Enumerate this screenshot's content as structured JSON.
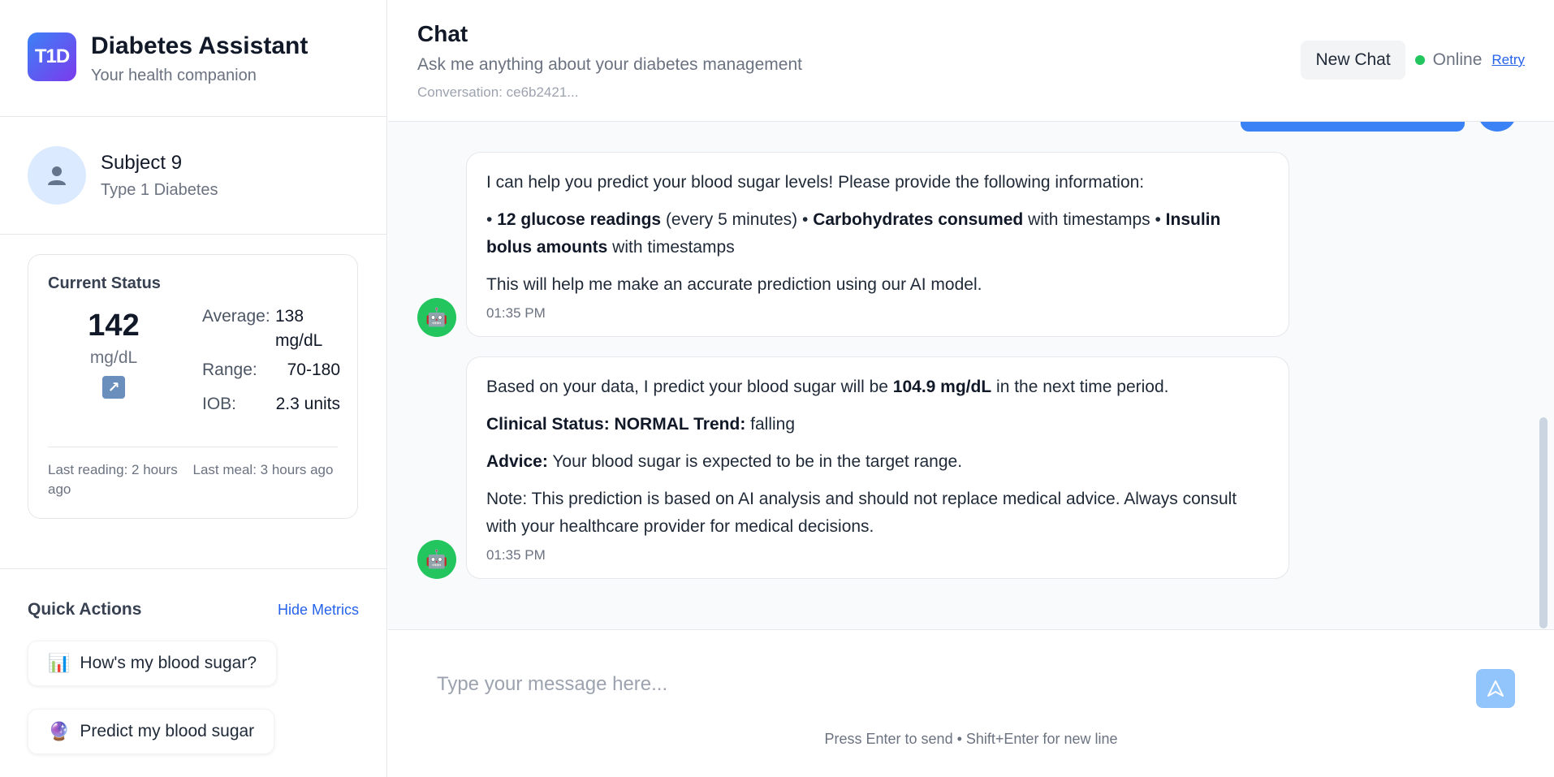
{
  "brand": {
    "logo": "T1D",
    "title": "Diabetes Assistant",
    "subtitle": "Your health companion"
  },
  "profile": {
    "avatar_icon": "person-icon",
    "name": "Subject 9",
    "type": "Type 1 Diabetes"
  },
  "status": {
    "title": "Current Status",
    "glucose_value": "142",
    "glucose_unit": "mg/dL",
    "trend_icon": "arrow-up-right-icon",
    "trend_glyph": "↗",
    "average_label": "Average:",
    "average_value": "138 mg/dL",
    "range_label": "Range:",
    "range_value": "70-180",
    "iob_label": "IOB:",
    "iob_value": "2.3 units",
    "last_reading": "Last reading: 2 hours ago",
    "last_meal": "Last meal: 3 hours ago"
  },
  "quick_actions": {
    "title": "Quick Actions",
    "hide_label": "Hide Metrics",
    "items": [
      {
        "icon": "📊",
        "label": "How's my blood sugar?"
      },
      {
        "icon": "🔮",
        "label": "Predict my blood sugar"
      }
    ]
  },
  "header": {
    "title": "Chat",
    "subtitle": "Ask me anything about your diabetes management",
    "conversation": "Conversation: ce6b2421...",
    "new_chat": "New Chat",
    "status": "Online",
    "retry": "Retry"
  },
  "messages": [
    {
      "avatar": "🤖",
      "intro": "I can help you predict your blood sugar levels! Please provide the following information:",
      "b1_pre": "• ",
      "b1_bold": "12 glucose readings",
      "b1_post": " (every 5 minutes) • ",
      "b2_bold": "Carbohydrates consumed",
      "b2_post": " with timestamps • ",
      "b3_bold": "Insulin bolus amounts",
      "b3_post": " with timestamps",
      "outro": "This will help me make an accurate prediction using our AI model.",
      "time": "01:35 PM"
    },
    {
      "avatar": "🤖",
      "p1_pre": "Based on your data, I predict your blood sugar will be ",
      "p1_bold": "104.9 mg/dL",
      "p1_post": " in the next time period.",
      "p2_bold": "Clinical Status: NORMAL Trend:",
      "p2_post": " falling",
      "p3_bold": "Advice:",
      "p3_post": " Your blood sugar is expected to be in the target range.",
      "p4": "Note: This prediction is based on AI analysis and should not replace medical advice. Always consult with your healthcare provider for medical decisions.",
      "time": "01:35 PM"
    }
  ],
  "composer": {
    "placeholder": "Type your message here...",
    "send_icon": "send-icon",
    "hint": "Press Enter to send • Shift+Enter for new line"
  }
}
